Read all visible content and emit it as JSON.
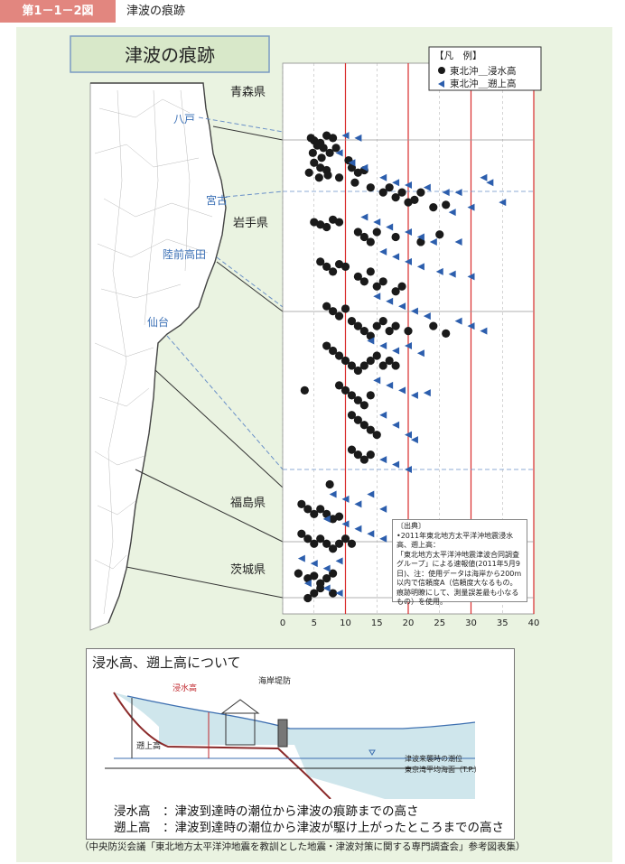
{
  "header": {
    "badge": "第1－1－2図",
    "title": "津波の痕跡"
  },
  "chart_title": "津波の痕跡",
  "legend": {
    "title": "【凡　例】",
    "items": [
      "東北沖＿浸水高",
      "東北沖＿遡上高"
    ]
  },
  "map_labels": {
    "prefectures": [
      "青森県",
      "岩手県",
      "福島県",
      "茨城県"
    ],
    "cities": [
      "八戸",
      "宮古",
      "陸前高田",
      "仙台"
    ]
  },
  "source_box": [
    "〔出典〕",
    "•2011年東北地方太平洋沖地震浸水高、遡上高：",
    "「東北地方太平洋沖地震津波合同調査グループ」による速報値(2011年5月9日)、注：使用データは海岸から200m以内で信頼度A（信頼度大なるもの。痕跡明瞭にして、測量誤差最も小なるもの）を使用。"
  ],
  "chart_data": {
    "type": "scatter",
    "xlim": [
      0,
      40
    ],
    "xticks": [
      0,
      5,
      10,
      15,
      20,
      25,
      30,
      35,
      40
    ],
    "ylim": [
      0,
      100
    ],
    "reference_lines": [
      10,
      20,
      30,
      40
    ],
    "series": [
      {
        "name": "東北沖＿浸水高",
        "marker": "circle",
        "color": "#1a1a1a",
        "points": [
          [
            4.5,
            6
          ],
          [
            5,
            6.5
          ],
          [
            6,
            7
          ],
          [
            7,
            5.5
          ],
          [
            8,
            6
          ],
          [
            5.5,
            7.5
          ],
          [
            6.5,
            8
          ],
          [
            4.8,
            9
          ],
          [
            6.2,
            10
          ],
          [
            7.5,
            9
          ],
          [
            8.5,
            8
          ],
          [
            5,
            11
          ],
          [
            6,
            12
          ],
          [
            7,
            12.5
          ],
          [
            4.2,
            13
          ],
          [
            5.8,
            14
          ],
          [
            7.2,
            13.5
          ],
          [
            9,
            14
          ],
          [
            10.5,
            10.5
          ],
          [
            11,
            12
          ],
          [
            12,
            13
          ],
          [
            13,
            12.5
          ],
          [
            11.5,
            15
          ],
          [
            14,
            16
          ],
          [
            16,
            17
          ],
          [
            17,
            16
          ],
          [
            18,
            18
          ],
          [
            19,
            17
          ],
          [
            20,
            19
          ],
          [
            21,
            18.5
          ],
          [
            22,
            17
          ],
          [
            24,
            20
          ],
          [
            26,
            19.5
          ],
          [
            5,
            23
          ],
          [
            6,
            23.5
          ],
          [
            7,
            24
          ],
          [
            8,
            22.5
          ],
          [
            9,
            23
          ],
          [
            12,
            25
          ],
          [
            13,
            26
          ],
          [
            14,
            27
          ],
          [
            15,
            25
          ],
          [
            18,
            26
          ],
          [
            22,
            27
          ],
          [
            25,
            25.5
          ],
          [
            6,
            31
          ],
          [
            7,
            32
          ],
          [
            8,
            33
          ],
          [
            9,
            31.5
          ],
          [
            10,
            32
          ],
          [
            12,
            34
          ],
          [
            13,
            35
          ],
          [
            14,
            33
          ],
          [
            15,
            36
          ],
          [
            16,
            35
          ],
          [
            18,
            37
          ],
          [
            19,
            36
          ],
          [
            7,
            40
          ],
          [
            8,
            41
          ],
          [
            9,
            42
          ],
          [
            10,
            40.5
          ],
          [
            11,
            43
          ],
          [
            12,
            44
          ],
          [
            13,
            45
          ],
          [
            14,
            46
          ],
          [
            15,
            44
          ],
          [
            16,
            43
          ],
          [
            17,
            45
          ],
          [
            18,
            44
          ],
          [
            20,
            45
          ],
          [
            24,
            44
          ],
          [
            26,
            45.5
          ],
          [
            7,
            48
          ],
          [
            8,
            49
          ],
          [
            9,
            50
          ],
          [
            10,
            51
          ],
          [
            11,
            52
          ],
          [
            12,
            53
          ],
          [
            13,
            52
          ],
          [
            14,
            51
          ],
          [
            15,
            50
          ],
          [
            16,
            52
          ],
          [
            17,
            51
          ],
          [
            18,
            52
          ],
          [
            3.5,
            57
          ],
          [
            9,
            56
          ],
          [
            10,
            57
          ],
          [
            11,
            58
          ],
          [
            12,
            59
          ],
          [
            13,
            60
          ],
          [
            14,
            58
          ],
          [
            11,
            62
          ],
          [
            12,
            63
          ],
          [
            13,
            64
          ],
          [
            14,
            65
          ],
          [
            15,
            66
          ],
          [
            11,
            69
          ],
          [
            12,
            70
          ],
          [
            13,
            71
          ],
          [
            14,
            70
          ],
          [
            7.5,
            76
          ],
          [
            3,
            80
          ],
          [
            4,
            81
          ],
          [
            5,
            82
          ],
          [
            6,
            81
          ],
          [
            7,
            82
          ],
          [
            8,
            83
          ],
          [
            9,
            82.5
          ],
          [
            3,
            86
          ],
          [
            4,
            87
          ],
          [
            5,
            88
          ],
          [
            6,
            87
          ],
          [
            7,
            88
          ],
          [
            8,
            89
          ],
          [
            9,
            88
          ],
          [
            10,
            87
          ],
          [
            11,
            88
          ],
          [
            2.5,
            94
          ],
          [
            4,
            95
          ],
          [
            5,
            94.5
          ],
          [
            6,
            96
          ],
          [
            7,
            95
          ],
          [
            8,
            94
          ],
          [
            4,
            99
          ],
          [
            5,
            98
          ],
          [
            6,
            97
          ],
          [
            8,
            98
          ]
        ]
      },
      {
        "name": "東北沖＿遡上高",
        "marker": "triangle",
        "color": "#2c5ead",
        "points": [
          [
            10,
            5.5
          ],
          [
            12,
            6
          ],
          [
            9,
            9
          ],
          [
            11,
            11
          ],
          [
            13,
            12
          ],
          [
            16,
            14
          ],
          [
            18,
            15
          ],
          [
            20,
            15.5
          ],
          [
            23,
            16
          ],
          [
            26,
            17
          ],
          [
            28,
            17
          ],
          [
            32,
            14
          ],
          [
            33,
            15
          ],
          [
            35,
            19
          ],
          [
            30,
            20
          ],
          [
            27,
            21
          ],
          [
            13,
            22
          ],
          [
            15,
            23
          ],
          [
            17,
            24
          ],
          [
            20,
            25
          ],
          [
            22,
            26
          ],
          [
            24,
            27
          ],
          [
            28,
            27
          ],
          [
            16,
            29
          ],
          [
            18,
            30
          ],
          [
            20,
            31
          ],
          [
            22,
            32
          ],
          [
            25,
            33
          ],
          [
            27,
            33.5
          ],
          [
            30,
            34
          ],
          [
            15,
            38
          ],
          [
            17,
            39
          ],
          [
            19,
            40
          ],
          [
            21,
            41
          ],
          [
            23,
            42
          ],
          [
            28,
            43
          ],
          [
            30,
            44
          ],
          [
            32,
            45
          ],
          [
            14,
            47
          ],
          [
            16,
            48
          ],
          [
            18,
            49
          ],
          [
            20,
            48
          ],
          [
            22,
            49.5
          ],
          [
            15,
            55
          ],
          [
            17,
            56
          ],
          [
            19,
            57
          ],
          [
            21,
            58
          ],
          [
            23,
            57.5
          ],
          [
            16,
            62
          ],
          [
            18,
            64
          ],
          [
            20,
            66
          ],
          [
            21,
            67
          ],
          [
            16,
            71
          ],
          [
            18,
            72
          ],
          [
            20,
            73
          ],
          [
            8,
            78
          ],
          [
            10,
            79
          ],
          [
            12,
            80
          ],
          [
            14,
            78
          ],
          [
            16,
            81
          ],
          [
            7,
            83
          ],
          [
            10,
            84
          ],
          [
            12,
            85
          ],
          [
            14,
            86
          ],
          [
            16,
            87
          ],
          [
            18,
            88
          ],
          [
            19,
            89
          ],
          [
            22,
            90
          ],
          [
            3,
            91
          ],
          [
            5,
            92
          ],
          [
            7,
            93
          ],
          [
            9,
            91.5
          ],
          [
            4,
            96
          ],
          [
            7,
            97
          ],
          [
            9,
            98
          ]
        ]
      }
    ]
  },
  "diagram": {
    "title": "浸水高、遡上高について",
    "labels": {
      "inundation": "浸水高",
      "runup": "遡上高",
      "seawall": "海岸堤防",
      "tide": "津波来襲時の潮位",
      "tp": "東京湾平均海面（T.P.）"
    },
    "definitions": [
      "浸水高　：津波到達時の潮位から津波の痕跡までの高さ",
      "遡上高　：津波到達時の潮位から津波が駆け上がったところまでの高さ"
    ]
  },
  "source_note": "（中央防災会議「東北地方太平洋沖地震を教訓とした地震・津波対策に関する専門調査会」参考図表集）"
}
